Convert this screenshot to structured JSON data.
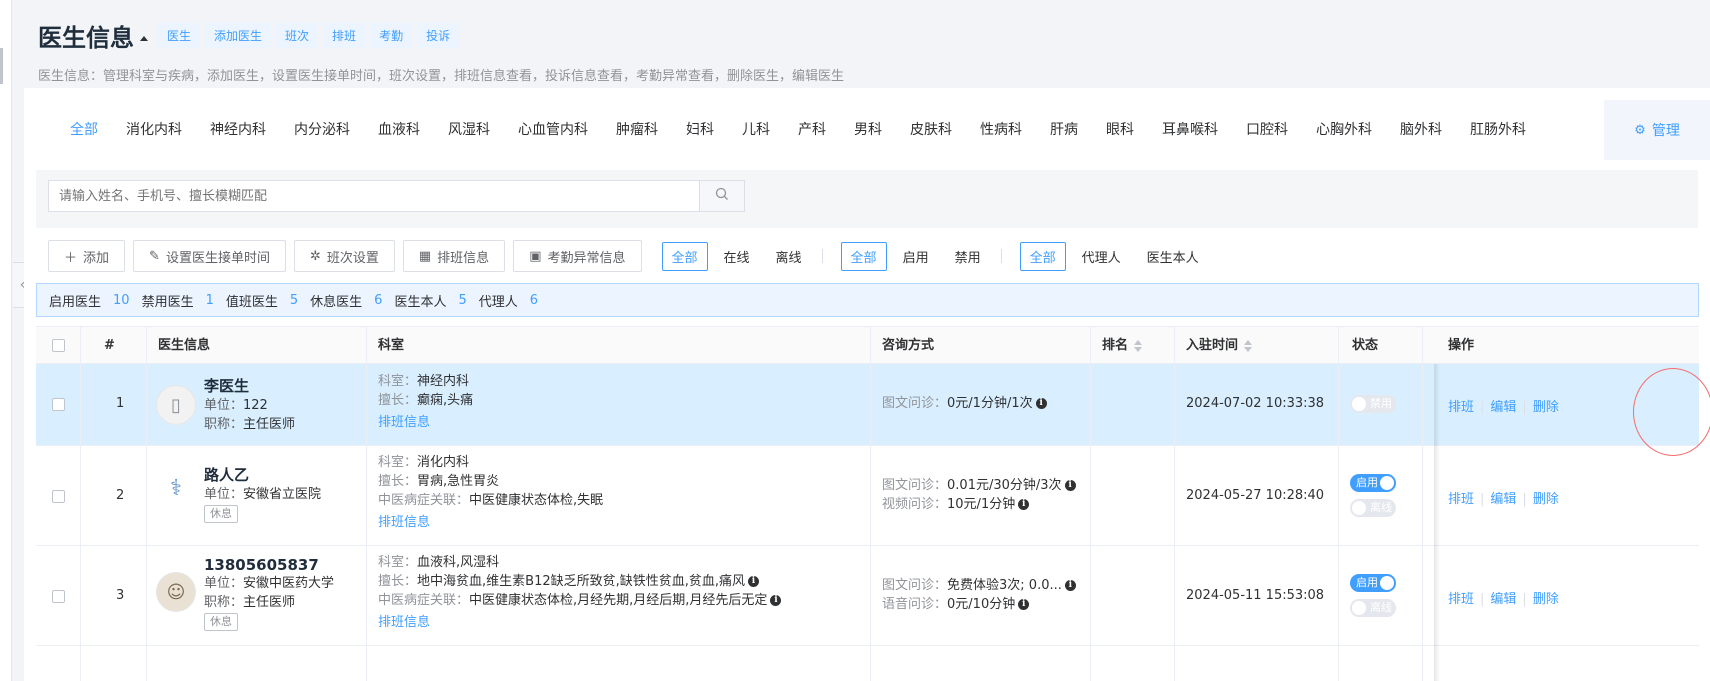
{
  "header": {
    "title": "医生信息",
    "quick_tags": [
      "医生",
      "添加医生",
      "班次",
      "排班",
      "考勤",
      "投诉"
    ],
    "subtitle": "医生信息：管理科室与疾病，添加医生，设置医生接单时间，班次设置，排班信息查看，投诉信息查看，考勤异常查看，删除医生，编辑医生"
  },
  "departments": [
    "全部",
    "消化内科",
    "神经内科",
    "内分泌科",
    "血液科",
    "风湿科",
    "心血管内科",
    "肿瘤科",
    "妇科",
    "儿科",
    "产科",
    "男科",
    "皮肤科",
    "性病科",
    "肝病",
    "眼科",
    "耳鼻喉科",
    "口腔科",
    "心胸外科",
    "脑外科",
    "肛肠外科"
  ],
  "manage_label": "管理",
  "search": {
    "placeholder": "请输入姓名、手机号、擅长模糊匹配"
  },
  "toolbar": {
    "add": "添加",
    "set_time": "设置医生接单时间",
    "shift": "班次设置",
    "schedule": "排班信息",
    "attendance": "考勤异常信息"
  },
  "filters": {
    "online": [
      "全部",
      "在线",
      "离线"
    ],
    "enabled": [
      "全部",
      "启用",
      "禁用"
    ],
    "agent": [
      "全部",
      "代理人",
      "医生本人"
    ]
  },
  "stats": [
    {
      "label": "启用医生",
      "value": "10"
    },
    {
      "label": "禁用医生",
      "value": "1"
    },
    {
      "label": "值班医生",
      "value": "5"
    },
    {
      "label": "休息医生",
      "value": "6"
    },
    {
      "label": "医生本人",
      "value": "5"
    },
    {
      "label": "代理人",
      "value": "6"
    }
  ],
  "table": {
    "headers": {
      "index": "#",
      "doctor": "医生信息",
      "dept": "科室",
      "consult": "咨询方式",
      "rank": "排名",
      "joined": "入驻时间",
      "status": "状态",
      "ops": "操作"
    },
    "rows": [
      {
        "index": "1",
        "name": "李医生",
        "unit": "122",
        "title": "主任医师",
        "rest": "",
        "dept": "神经内科",
        "skill": "癫痫,头痛",
        "tcm": "",
        "schedule_link": "排班信息",
        "consult": [
          {
            "label": "图文问诊：",
            "value": "0元/1分钟/1次"
          }
        ],
        "joined": "2024-07-02 10:33:38",
        "switch1": "禁用",
        "switch2": ""
      },
      {
        "index": "2",
        "name": "路人乙",
        "unit": "安徽省立医院",
        "title": "",
        "rest": "休息",
        "dept": "消化内科",
        "skill": "胃病,急性胃炎",
        "tcm": "中医健康状态体检,失眠",
        "schedule_link": "排班信息",
        "consult": [
          {
            "label": "图文问诊：",
            "value": "0.01元/30分钟/3次"
          },
          {
            "label": "视频问诊：",
            "value": "10元/1分钟"
          }
        ],
        "joined": "2024-05-27 10:28:40",
        "switch1": "启用",
        "switch2": "离线"
      },
      {
        "index": "3",
        "name": "13805605837",
        "unit": "安徽中医药大学",
        "title": "主任医师",
        "rest": "休息",
        "dept": "血液科,风湿科",
        "skill": "地中海贫血,维生素B12缺乏所致贫,缺铁性贫血,贫血,痛风",
        "tcm": "中医健康状态体检,月经先期,月经后期,月经先后无定",
        "schedule_link": "排班信息",
        "consult": [
          {
            "label": "图文问诊：",
            "value": "免费体验3次; 0.0..."
          },
          {
            "label": "语音问诊：",
            "value": "0元/10分钟"
          }
        ],
        "joined": "2024-05-11 15:53:08",
        "switch1": "启用",
        "switch2": "离线"
      }
    ],
    "labels": {
      "unit": "单位：",
      "title": "职称：",
      "dept": "科室：",
      "skill": "擅长：",
      "tcm": "中医病症关联："
    },
    "ops": [
      "排班",
      "编辑",
      "删除"
    ]
  }
}
